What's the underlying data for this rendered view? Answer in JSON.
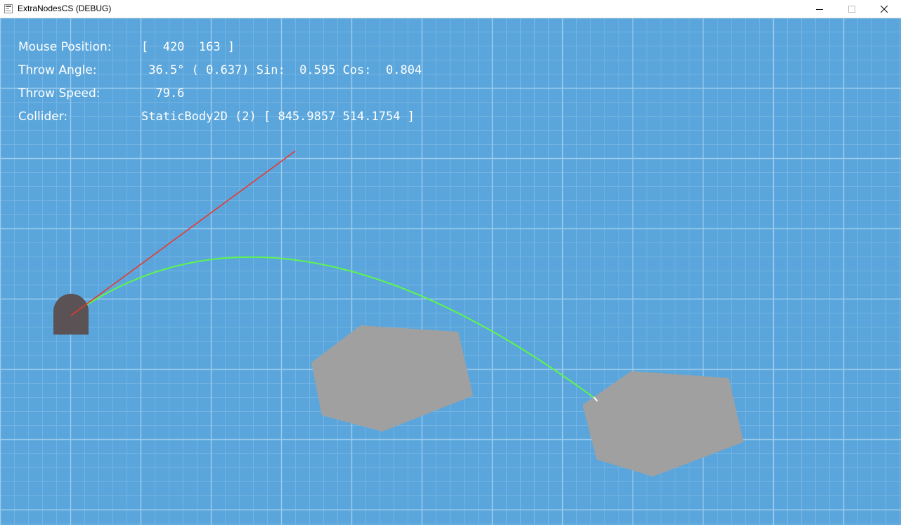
{
  "window": {
    "title": "ExtraNodesCS (DEBUG)",
    "icon": "godot-app-icon",
    "controls": {
      "minimize": "–",
      "maximize": "☐",
      "close": "✕"
    }
  },
  "colors": {
    "background": "#5aa6dc",
    "grid_major": "#9ccbed",
    "grid_minor": "#72b3e2",
    "throw_line": "#e8392d",
    "trajectory": "#5ff54e",
    "thrower": "#5a5254",
    "rock": "#a0a0a0",
    "hud_text": "#ffffff"
  },
  "hud": {
    "mouse_position": {
      "label": "Mouse Position:",
      "value": "[  420  163 ]"
    },
    "throw_angle": {
      "label": "Throw Angle:",
      "value": " 36.5° ( 0.637) Sin:  0.595 Cos:  0.804"
    },
    "throw_speed": {
      "label": "Throw Speed:",
      "value": "  79.6"
    },
    "collider": {
      "label": "Collider:",
      "value": "StaticBody2D (2) [ 845.9857 514.1754 ]"
    }
  }
}
